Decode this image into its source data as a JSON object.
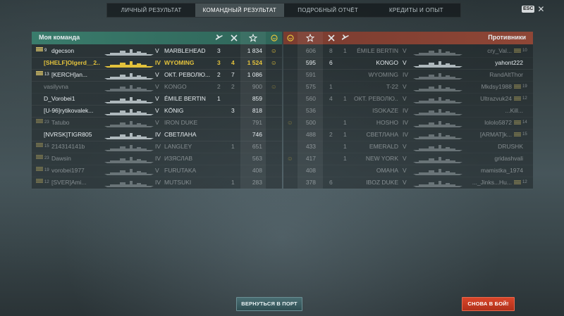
{
  "tabs": [
    {
      "label": "ЛИЧНЫЙ РЕЗУЛЬТАТ",
      "active": false
    },
    {
      "label": "КОМАНДНЫЙ РЕЗУЛЬТАТ",
      "active": true
    },
    {
      "label": "ПОДРОБНЫЙ ОТЧЁТ",
      "active": false
    },
    {
      "label": "КРЕДИТЫ И ОПЫТ",
      "active": false
    }
  ],
  "esc_label": "ESC",
  "left_team": {
    "title": "Моя команда",
    "rows": [
      {
        "badge": "9",
        "player": "dgecson",
        "tier": "V",
        "ship": "MARBLEHEAD",
        "planes": "3",
        "kills": "",
        "xp": "1 834",
        "medal": true,
        "style": "normal"
      },
      {
        "badge": "",
        "player": "[SHELF]Olgerd__2...",
        "tier": "IV",
        "ship": "WYOMING",
        "planes": "3",
        "kills": "4",
        "xp": "1 524",
        "medal": true,
        "style": "highlight"
      },
      {
        "badge": "13",
        "player": "[KERCH]an...",
        "tier": "V",
        "ship": "ОКТ. РЕВОЛЮ...",
        "planes": "2",
        "kills": "7",
        "xp": "1 086",
        "medal": false,
        "style": "normal"
      },
      {
        "badge": "",
        "player": "vasilyvna",
        "tier": "V",
        "ship": "KONGO",
        "planes": "2",
        "kills": "2",
        "xp": "900",
        "medal": true,
        "style": "dim"
      },
      {
        "badge": "",
        "player": "D_Vorobei1",
        "tier": "V",
        "ship": "ÉMILE BERTIN",
        "planes": "1",
        "kills": "",
        "xp": "859",
        "medal": false,
        "style": "normal"
      },
      {
        "badge": "",
        "player": "[U-96]rytikovalek...",
        "tier": "V",
        "ship": "KÖNIG",
        "planes": "",
        "kills": "3",
        "xp": "818",
        "medal": false,
        "style": "normal"
      },
      {
        "badge": "23",
        "player": "Tatubo",
        "tier": "V",
        "ship": "IRON DUKE",
        "planes": "",
        "kills": "",
        "xp": "791",
        "medal": false,
        "style": "dim"
      },
      {
        "badge": "",
        "player": "[NVRSK]TIGR805",
        "tier": "IV",
        "ship": "СВЕТЛАНА",
        "planes": "",
        "kills": "",
        "xp": "746",
        "medal": false,
        "style": "normal"
      },
      {
        "badge": "15",
        "player": "214314141b",
        "tier": "IV",
        "ship": "LANGLEY",
        "planes": "",
        "kills": "1",
        "xp": "651",
        "medal": false,
        "style": "dim"
      },
      {
        "badge": "23",
        "player": "Dawsin",
        "tier": "IV",
        "ship": "ИЗЯСЛАВ",
        "planes": "",
        "kills": "",
        "xp": "563",
        "medal": false,
        "style": "dim"
      },
      {
        "badge": "19",
        "player": "vorobei1977",
        "tier": "V",
        "ship": "FURUTAKA",
        "planes": "",
        "kills": "",
        "xp": "408",
        "medal": false,
        "style": "dim"
      },
      {
        "badge": "12",
        "player": "[SVER]Ami...",
        "tier": "IV",
        "ship": "MUTSUKI",
        "planes": "",
        "kills": "1",
        "xp": "283",
        "medal": false,
        "style": "dim"
      }
    ]
  },
  "right_team": {
    "title": "Противники",
    "rows": [
      {
        "medal": false,
        "xp": "606",
        "kills": "8",
        "planes": "1",
        "ship": "ÉMILE BERTIN",
        "tier": "V",
        "player": "cry_Val...",
        "badge": "10",
        "style": "dim"
      },
      {
        "medal": false,
        "xp": "595",
        "kills": "6",
        "planes": "",
        "ship": "KONGO",
        "tier": "V",
        "player": "yahont222",
        "badge": "",
        "style": "normal"
      },
      {
        "medal": false,
        "xp": "591",
        "kills": "",
        "planes": "",
        "ship": "WYOMING",
        "tier": "IV",
        "player": "RandAltThor",
        "badge": "",
        "style": "dim"
      },
      {
        "medal": false,
        "xp": "575",
        "kills": "1",
        "planes": "",
        "ship": "T-22",
        "tier": "V",
        "player": "Mkdsy1988",
        "badge": "19",
        "style": "dim"
      },
      {
        "medal": false,
        "xp": "560",
        "kills": "4",
        "planes": "1",
        "ship": "ОКТ. РЕВОЛЮ...",
        "tier": "V",
        "player": "Ultrazvuk24",
        "badge": "12",
        "style": "dim"
      },
      {
        "medal": false,
        "xp": "536",
        "kills": "",
        "planes": "",
        "ship": "ISOKAZE",
        "tier": "IV",
        "player": "...Kill...",
        "badge": "",
        "style": "dim"
      },
      {
        "medal": true,
        "xp": "500",
        "kills": "",
        "planes": "1",
        "ship": "HOSHO",
        "tier": "IV",
        "player": "lololo5872",
        "badge": "14",
        "style": "dim"
      },
      {
        "medal": false,
        "xp": "488",
        "kills": "2",
        "planes": "1",
        "ship": "СВЕТЛАНА",
        "tier": "IV",
        "player": "[ARMAT]k...",
        "badge": "15",
        "style": "dim"
      },
      {
        "medal": false,
        "xp": "433",
        "kills": "",
        "planes": "1",
        "ship": "EMERALD",
        "tier": "V",
        "player": "DRUSHK",
        "badge": "",
        "style": "dim"
      },
      {
        "medal": true,
        "xp": "417",
        "kills": "",
        "planes": "1",
        "ship": "NEW YORK",
        "tier": "V",
        "player": "gridashvali",
        "badge": "",
        "style": "dim"
      },
      {
        "medal": false,
        "xp": "408",
        "kills": "",
        "planes": "",
        "ship": "OMAHA",
        "tier": "V",
        "player": "mamistka_1974",
        "badge": "",
        "style": "dim"
      },
      {
        "medal": false,
        "xp": "378",
        "kills": "6",
        "planes": "",
        "ship": "IBOZ DUKE",
        "tier": "V",
        "player": "..._Jinks...Hu...",
        "badge": "12",
        "style": "dim"
      }
    ]
  },
  "buttons": {
    "port": "ВЕРНУТЬСЯ В ПОРТ",
    "battle": "СНОВА В БОЙ!"
  },
  "colors": {
    "ally": "#3a7c6c",
    "enemy": "#8f4636",
    "highlight": "#e3c23c",
    "battle_button": "#d9462a"
  }
}
